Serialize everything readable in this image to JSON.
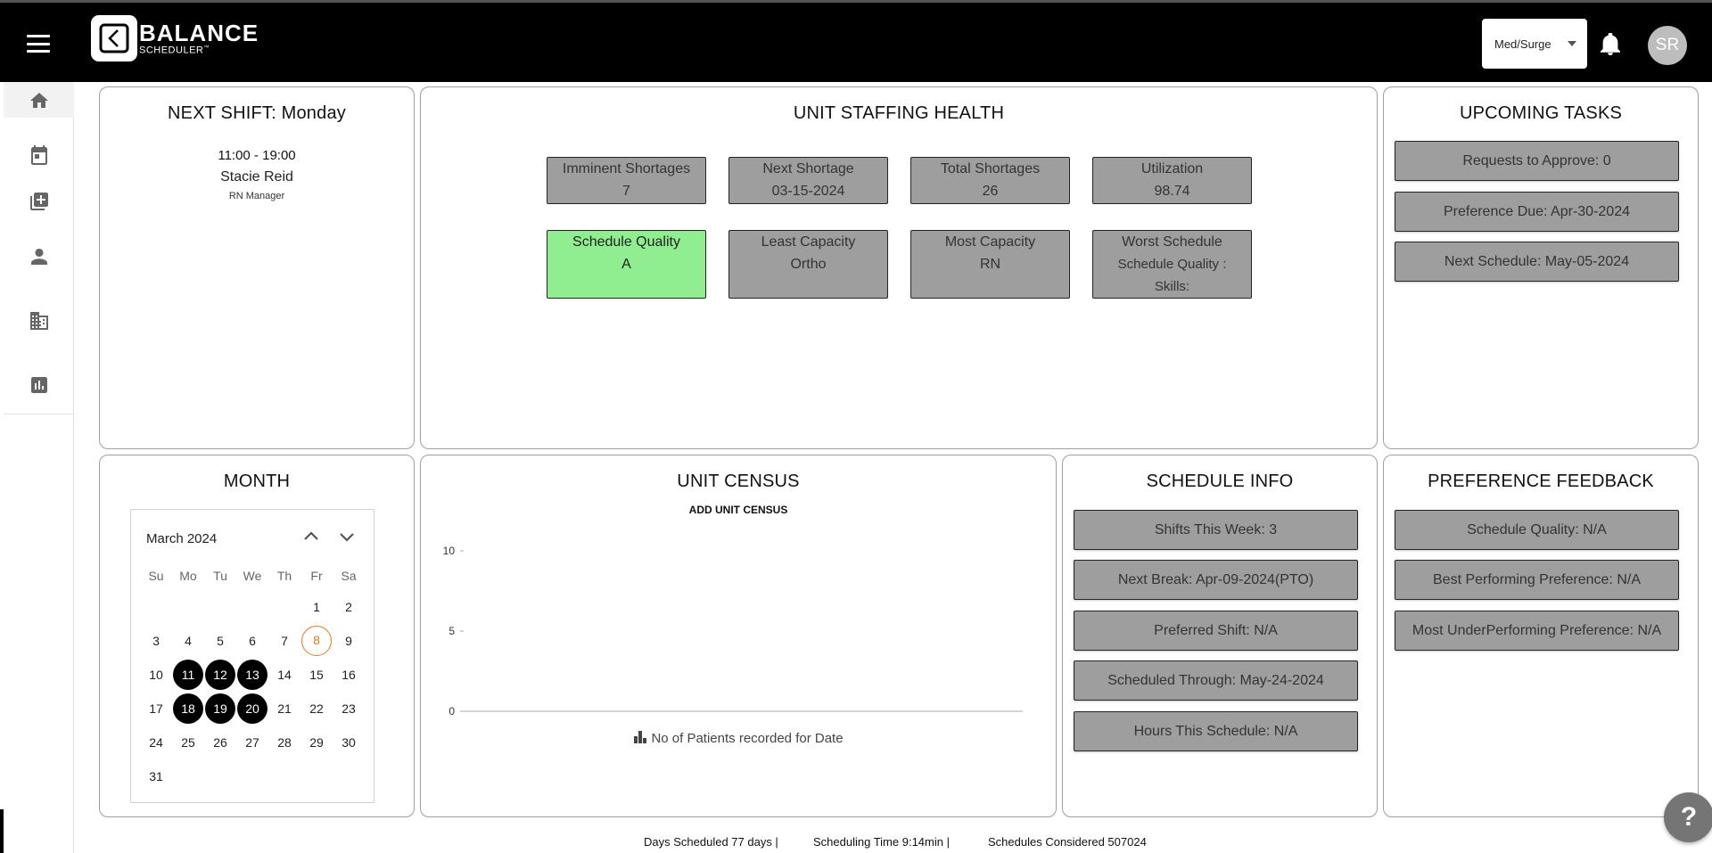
{
  "header": {
    "brand_title": "BALANCE",
    "brand_subtitle": "SCHEDULER",
    "brand_tm": "™",
    "unit_selected": "Med/Surge",
    "avatar_initials": "SR"
  },
  "sidebar": {
    "items": [
      {
        "icon": "home-icon",
        "active": true
      },
      {
        "icon": "calendar-icon"
      },
      {
        "icon": "add-library-icon"
      },
      {
        "icon": "person-icon"
      },
      {
        "icon": "business-icon"
      },
      {
        "icon": "assessment-icon"
      }
    ]
  },
  "next_shift": {
    "title": "NEXT SHIFT: Monday",
    "time": "11:00 - 19:00",
    "name": "Stacie Reid",
    "role": "RN Manager"
  },
  "staffing": {
    "title": "UNIT STAFFING HEALTH",
    "tiles": [
      {
        "label": "Imminent Shortages",
        "value": "7"
      },
      {
        "label": "Next Shortage",
        "value": "03-15-2024"
      },
      {
        "label": "Total Shortages",
        "value": "26"
      },
      {
        "label": "Utilization",
        "value": "98.74"
      },
      {
        "label": "Schedule Quality",
        "value": "A"
      },
      {
        "label": "Least Capacity",
        "value": "Ortho"
      },
      {
        "label": "Most Capacity",
        "value": "RN"
      },
      {
        "label": "Worst Schedule",
        "value": "Schedule Quality :",
        "value2": "Skills:"
      }
    ],
    "quality_color": "#90ee90"
  },
  "tasks": {
    "title": "UPCOMING TASKS",
    "items": [
      "Requests to Approve: 0",
      "Preference Due: Apr-30-2024",
      "Next Schedule: May-05-2024"
    ]
  },
  "month": {
    "title": "MONTH",
    "label": "March 2024",
    "weekdays": [
      "Su",
      "Mo",
      "Tu",
      "We",
      "Th",
      "Fr",
      "Sa"
    ],
    "first_weekday": 5,
    "days_in_month": 31,
    "today": 8,
    "selected_days": [
      11,
      12,
      13,
      18,
      19,
      20
    ],
    "today_color": "#e8751a"
  },
  "census": {
    "title": "UNIT CENSUS",
    "add_label": "ADD UNIT CENSUS",
    "legend_label": "No of Patients recorded for Date",
    "chart_data": {
      "type": "bar",
      "categories": [],
      "series": [
        {
          "name": "No of Patients recorded for Date",
          "values": []
        }
      ],
      "yticks": [
        0,
        5,
        10
      ],
      "ylim": [
        0,
        10
      ],
      "grid": false,
      "legend": "bottom"
    }
  },
  "schedule_info": {
    "title": "SCHEDULE INFO",
    "items": [
      "Shifts This Week: 3",
      "Next Break: Apr-09-2024(PTO)",
      "Preferred Shift: N/A",
      "Scheduled Through: May-24-2024",
      "Hours This Schedule: N/A"
    ]
  },
  "preference": {
    "title": "PREFERENCE FEEDBACK",
    "items": [
      "Schedule Quality: N/A",
      "Best Performing Preference: N/A",
      "Most UnderPerforming Preference: N/A"
    ]
  },
  "footer": {
    "days_scheduled": "Days Scheduled 77 days |",
    "scheduling_time": "Scheduling Time 9:14min |",
    "schedules_considered": "Schedules Considered 507024"
  },
  "help_label": "?"
}
